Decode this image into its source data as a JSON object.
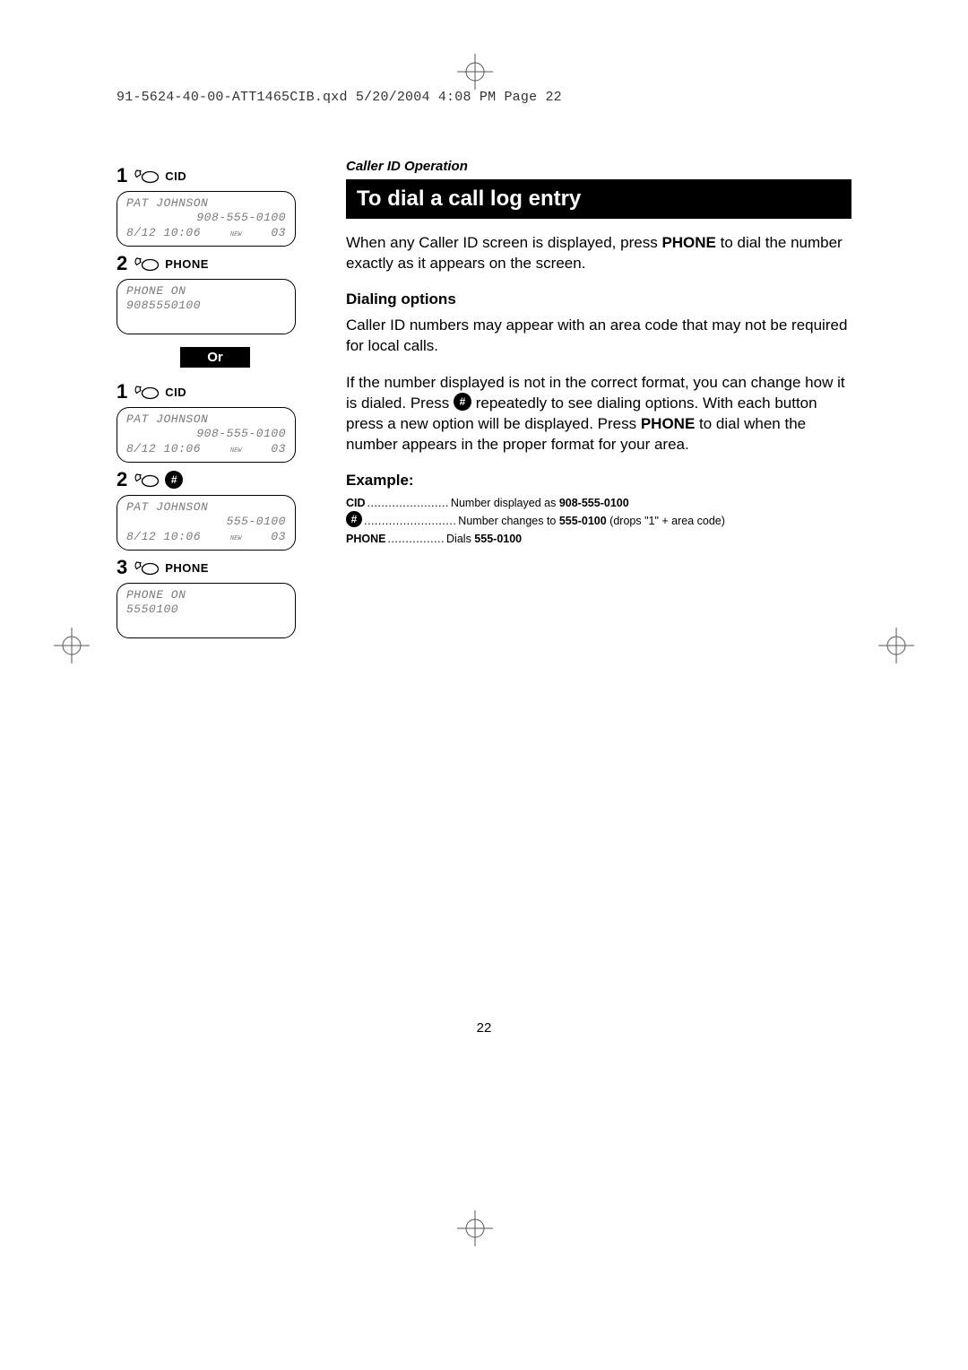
{
  "runhead": "91-5624-40-00-ATT1465CIB.qxd  5/20/2004  4:08 PM  Page 22",
  "left": {
    "seqA": {
      "step1": {
        "num": "1",
        "label": "CID",
        "lcd": {
          "l1": "PAT JOHNSON",
          "l2": "908-555-0100",
          "l3a": "8/12 10:06",
          "l3s": "NEW",
          "l3b": "03"
        }
      },
      "step2": {
        "num": "2",
        "label": "PHONE",
        "lcd": {
          "l1": "PHONE ON",
          "l2": "9085550100"
        }
      }
    },
    "or": "Or",
    "seqB": {
      "step1": {
        "num": "1",
        "label": "CID",
        "lcd": {
          "l1": "PAT JOHNSON",
          "l2": "908-555-0100",
          "l3a": "8/12 10:06",
          "l3s": "NEW",
          "l3b": "03"
        }
      },
      "step2": {
        "num": "2",
        "pound": "#",
        "lcd": {
          "l1": "PAT JOHNSON",
          "l2": "555-0100",
          "l3a": "8/12 10:06",
          "l3s": "NEW",
          "l3b": "03"
        }
      },
      "step3": {
        "num": "3",
        "label": "PHONE",
        "lcd": {
          "l1": "PHONE ON",
          "l2": "5550100"
        }
      }
    }
  },
  "right": {
    "section": "Caller ID Operation",
    "title": "To dial a call log entry",
    "p1a": "When any Caller ID screen is displayed, press ",
    "p1b": "PHONE",
    "p1c": " to dial the number exactly as it appears on the screen.",
    "h2": "Dialing options",
    "p2": "Caller ID numbers may appear with an area code that may not be required for local calls.",
    "p3a": "If the number displayed is not in the correct format, you can change how it is dialed. Press ",
    "p3pound": "#",
    "p3b": " repeatedly to see dialing options. With each button press a new option will be displayed. Press ",
    "p3c": "PHONE",
    "p3d": " to dial when the number appears in the proper format for your area.",
    "h3": "Example:",
    "ex": {
      "r1": {
        "key": "CID",
        "dots": ".......................",
        "txt": "Number displayed as ",
        "bold": "908-555-0100"
      },
      "r2": {
        "key": "#",
        "dots": "..........................",
        "txt": "Number changes to ",
        "bold": "555-0100",
        "tail": " (drops \"1\" + area code)"
      },
      "r3": {
        "key": "PHONE",
        "dots": "................",
        "txt": "Dials ",
        "bold": "555-0100"
      }
    }
  },
  "pagenum": "22"
}
